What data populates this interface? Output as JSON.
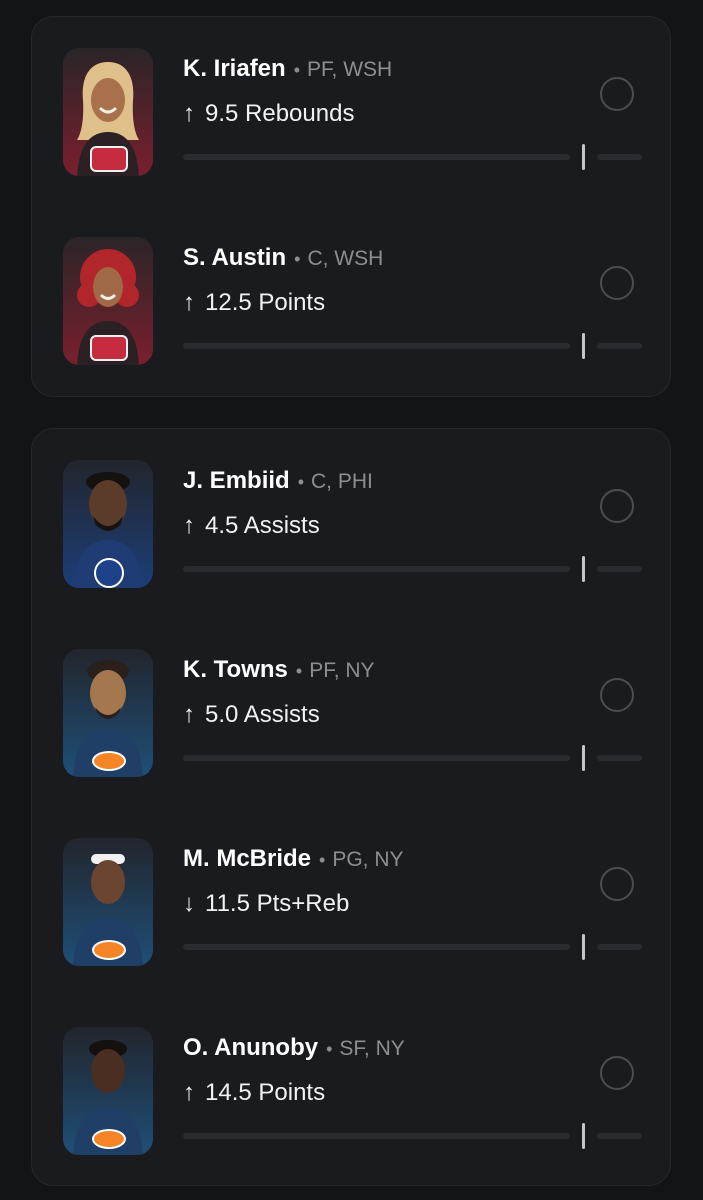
{
  "groups": [
    {
      "players": [
        {
          "name": "K. Iriafen",
          "position": "PF, WSH",
          "direction_icon": "arrow-up-icon",
          "arrow": "↑",
          "stat": "9.5 Rebounds",
          "team_logo": "mystics-logo"
        },
        {
          "name": "S. Austin",
          "position": "C, WSH",
          "direction_icon": "arrow-up-icon",
          "arrow": "↑",
          "stat": "12.5 Points",
          "team_logo": "mystics-logo"
        }
      ]
    },
    {
      "players": [
        {
          "name": "J. Embiid",
          "position": "C, PHI",
          "direction_icon": "arrow-up-icon",
          "arrow": "↑",
          "stat": "4.5 Assists",
          "team_logo": "76ers-logo"
        },
        {
          "name": "K. Towns",
          "position": "PF, NY",
          "direction_icon": "arrow-up-icon",
          "arrow": "↑",
          "stat": "5.0 Assists",
          "team_logo": "knicks-logo"
        },
        {
          "name": "M. McBride",
          "position": "PG, NY",
          "direction_icon": "arrow-down-icon",
          "arrow": "↓",
          "stat": "11.5 Pts+Reb",
          "team_logo": "knicks-logo"
        },
        {
          "name": "O. Anunoby",
          "position": "SF, NY",
          "direction_icon": "arrow-up-icon",
          "arrow": "↑",
          "stat": "14.5 Points",
          "team_logo": "knicks-logo"
        }
      ]
    }
  ],
  "separator": "•",
  "colors": {
    "background": "#131417",
    "card": "#1a1b1f",
    "mystics_tile": "#7a1f2d",
    "sixers_tile": "#1c3e78",
    "knicks_tile": "#1e4f78",
    "knicks_orange": "#f58426",
    "text_secondary": "#8d8e93"
  }
}
